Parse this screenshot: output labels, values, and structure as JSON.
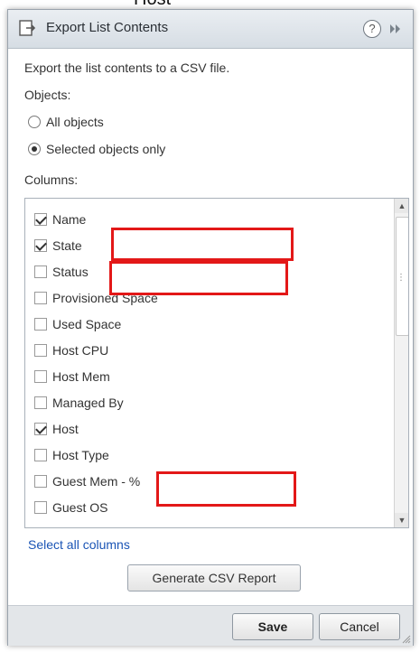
{
  "background_fragment": "Host",
  "dialog": {
    "title": "Export List Contents",
    "help_symbol": "?",
    "description": "Export the list contents to a CSV file.",
    "objects_label": "Objects:",
    "options": [
      {
        "label": "All objects",
        "selected": false
      },
      {
        "label": "Selected objects only",
        "selected": true
      }
    ],
    "columns_label": "Columns:",
    "columns": [
      {
        "label": "Name",
        "checked": true
      },
      {
        "label": "State",
        "checked": true
      },
      {
        "label": "Status",
        "checked": false
      },
      {
        "label": "Provisioned Space",
        "checked": false
      },
      {
        "label": "Used Space",
        "checked": false
      },
      {
        "label": "Host CPU",
        "checked": false
      },
      {
        "label": "Host Mem",
        "checked": false
      },
      {
        "label": "Managed By",
        "checked": false
      },
      {
        "label": "Host",
        "checked": true
      },
      {
        "label": "Host Type",
        "checked": false
      },
      {
        "label": "Guest Mem - %",
        "checked": false
      },
      {
        "label": "Guest OS",
        "checked": false
      }
    ],
    "select_all_link": "Select all columns",
    "generate_button": "Generate CSV Report",
    "save_button": "Save",
    "cancel_button": "Cancel"
  },
  "colors": {
    "link": "#1a54b5",
    "annotation": "#e31818",
    "titlebar": "#dfe5ea"
  }
}
